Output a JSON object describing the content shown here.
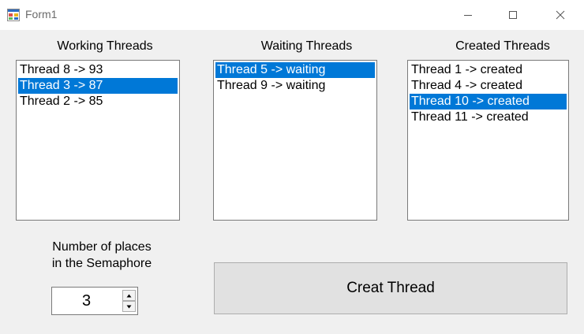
{
  "window": {
    "title": "Form1",
    "controls": [
      "minimize-icon",
      "maximize-icon",
      "close-icon"
    ]
  },
  "lists": {
    "working": {
      "header": "Working Threads",
      "items": [
        {
          "text": "Thread 8 -> 93",
          "selected": false
        },
        {
          "text": "Thread 3 -> 87",
          "selected": true
        },
        {
          "text": "Thread 2 -> 85",
          "selected": false
        }
      ]
    },
    "waiting": {
      "header": "Waiting Threads",
      "items": [
        {
          "text": "Thread 5 -> waiting",
          "selected": true
        },
        {
          "text": "Thread 9 -> waiting",
          "selected": false
        }
      ]
    },
    "created": {
      "header": "Created Threads",
      "items": [
        {
          "text": "Thread 1 -> created",
          "selected": false
        },
        {
          "text": "Thread 4 -> created",
          "selected": false
        },
        {
          "text": "Thread 10 -> created",
          "selected": true
        },
        {
          "text": "Thread 11 -> created",
          "selected": false
        }
      ]
    }
  },
  "semaphore": {
    "label_line1": "Number of places",
    "label_line2": "in the Semaphore",
    "value": "3"
  },
  "actions": {
    "creat_thread_label": "Creat Thread"
  },
  "colors": {
    "selection": "#0078d7",
    "window_bg": "#f0f0f0"
  }
}
